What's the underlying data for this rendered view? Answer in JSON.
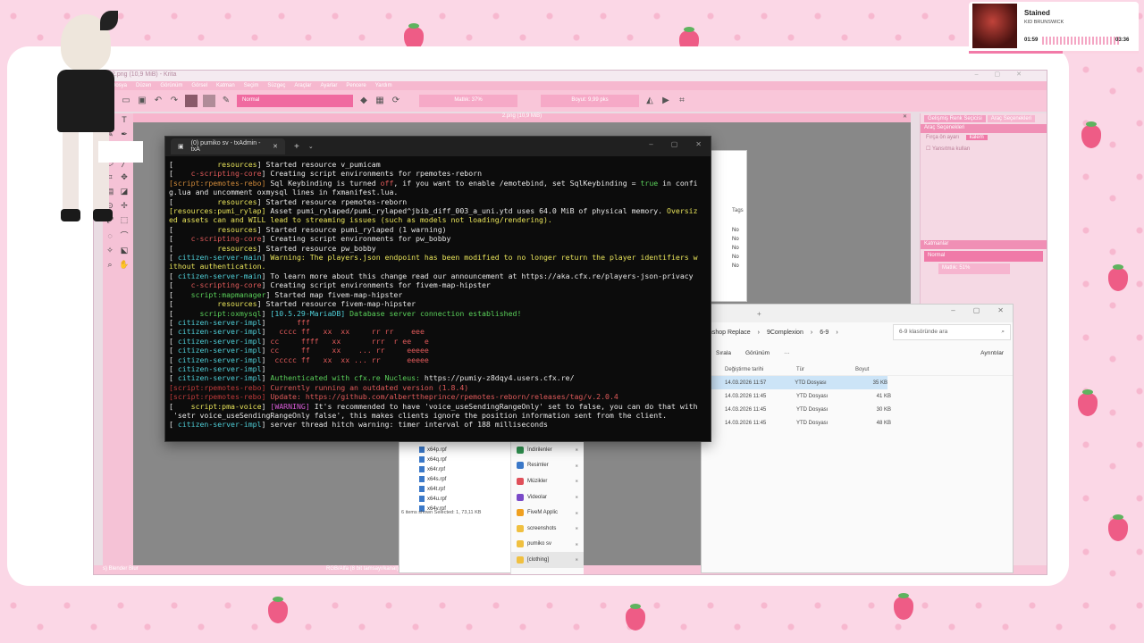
{
  "music": {
    "title": "Stained",
    "artist": "KID BRUNSWICK",
    "elapsed": "01:59",
    "total": "03:36",
    "progress": 0.55
  },
  "krita": {
    "title": "2.png (10,9 MiB) - Krita",
    "menu": [
      "Dosya",
      "Düzen",
      "Görünüm",
      "Görsel",
      "Katman",
      "Seçim",
      "Süzgeç",
      "Araçlar",
      "Ayarlar",
      "Pencere",
      "Yardım"
    ],
    "blend_mode": "Normal",
    "opacity": "Matlık: 37%",
    "size": "Boyut: 9,99 pks",
    "doc_title": "2.png (10,9 MiB)",
    "status_left": "s) Blender Blur",
    "status_mid": "RGB/Alfa (8 bit tamsayı/kanal) sRGB-elle-V2-srgbtrc.icc",
    "dock_tabs": [
      "Gelişmiş Renk Seçicisi",
      "Araç Seçenekleri"
    ],
    "fırça": {
      "label": "Araç Seçenekleri",
      "row": "Fırça ön ayarı",
      "value": "kalem",
      "check": "Yansıtma kullan"
    },
    "layers": {
      "title": "Katmanlar",
      "blend": "Normal",
      "opacity": "Matlık: 51%"
    }
  },
  "terminal": {
    "tab_title": "(0) pumiko sv - txAdmin - txA",
    "lines": [
      [
        [
          "c-w",
          "[          "
        ],
        [
          "c-y",
          "resources"
        ],
        [
          "c-w",
          "] Started resource v_pumicam"
        ]
      ],
      [
        [
          "c-w",
          "[    "
        ],
        [
          "c-r",
          "c-scripting-core"
        ],
        [
          "c-w",
          "] Creating script environments for rpemotes-reborn"
        ]
      ],
      [
        [
          "c-o",
          "[script:rpemotes-rebo]"
        ],
        [
          "c-w",
          " Sql Keybinding is turned "
        ],
        [
          "c-r",
          "off"
        ],
        [
          "c-w",
          ", if you want to enable /emotebind, set SqlKeybinding = "
        ],
        [
          "c-g",
          "true"
        ],
        [
          "c-w",
          " in confi"
        ]
      ],
      [
        [
          "c-w",
          "g.lua and uncomment oxmysql lines in fxmanifest.lua."
        ]
      ],
      [
        [
          "c-w",
          "[          "
        ],
        [
          "c-y",
          "resources"
        ],
        [
          "c-w",
          "] Started resource rpemotes-reborn"
        ]
      ],
      [
        [
          "c-y",
          "[resources:pumi_rylap]"
        ],
        [
          "c-w",
          " Asset pumi_rylaped/pumi_rylaped^jbib_diff_003_a_uni.ytd uses 64.0 MiB of physical memory. "
        ],
        [
          "c-y",
          "Oversiz"
        ]
      ],
      [
        [
          "c-y",
          "ed assets can and WILL lead to streaming issues (such as models not loading/rendering)."
        ]
      ],
      [
        [
          "c-w",
          "[          "
        ],
        [
          "c-y",
          "resources"
        ],
        [
          "c-w",
          "] Started resource pumi_rylaped (1 warning)"
        ]
      ],
      [
        [
          "c-w",
          "[    "
        ],
        [
          "c-r",
          "c-scripting-core"
        ],
        [
          "c-w",
          "] Creating script environments for pw_bobby"
        ]
      ],
      [
        [
          "c-w",
          "[          "
        ],
        [
          "c-y",
          "resources"
        ],
        [
          "c-w",
          "] Started resource pw_bobby"
        ]
      ],
      [
        [
          "c-w",
          "[ "
        ],
        [
          "c-c",
          "citizen-server-main"
        ],
        [
          "c-w",
          "] "
        ],
        [
          "c-y",
          "Warning: The players.json endpoint has been modified to no longer return the player identifiers w"
        ]
      ],
      [
        [
          "c-y",
          "ithout authentication."
        ]
      ],
      [
        [
          "c-w",
          "[ "
        ],
        [
          "c-c",
          "citizen-server-main"
        ],
        [
          "c-w",
          "] To learn more about this change read our announcement at https://aka.cfx.re/players-json-privacy"
        ]
      ],
      [
        [
          "c-w",
          "[    "
        ],
        [
          "c-r",
          "c-scripting-core"
        ],
        [
          "c-w",
          "] Creating script environments for fivem-map-hipster"
        ]
      ],
      [
        [
          "c-w",
          "[    "
        ],
        [
          "c-g",
          "script:mapmanager"
        ],
        [
          "c-w",
          "] Started map fivem-map-hipster"
        ]
      ],
      [
        [
          "c-w",
          "[          "
        ],
        [
          "c-y",
          "resources"
        ],
        [
          "c-w",
          "] Started resource fivem-map-hipster"
        ]
      ],
      [
        [
          "c-w",
          "[      "
        ],
        [
          "c-g",
          "script:oxmysql"
        ],
        [
          "c-w",
          "] "
        ],
        [
          "c-c",
          "[10.5.29-MariaDB]"
        ],
        [
          "c-g",
          " Database server connection established!"
        ]
      ],
      [
        [
          "c-w",
          "[ "
        ],
        [
          "c-c",
          "citizen-server-impl"
        ],
        [
          "c-w",
          "]       "
        ],
        [
          "c-r",
          "fff"
        ]
      ],
      [
        [
          "c-w",
          "[ "
        ],
        [
          "c-c",
          "citizen-server-impl"
        ],
        [
          "c-w",
          "]   "
        ],
        [
          "c-r",
          "cccc ff   xx  xx     rr rr    eee"
        ]
      ],
      [
        [
          "c-w",
          "[ "
        ],
        [
          "c-c",
          "citizen-server-impl"
        ],
        [
          "c-w",
          "] "
        ],
        [
          "c-r",
          "cc     ffff   xx       rrr  r ee   e"
        ]
      ],
      [
        [
          "c-w",
          "[ "
        ],
        [
          "c-c",
          "citizen-server-impl"
        ],
        [
          "c-w",
          "] "
        ],
        [
          "c-r",
          "cc     ff     xx    ... rr     eeeee"
        ]
      ],
      [
        [
          "c-w",
          "[ "
        ],
        [
          "c-c",
          "citizen-server-impl"
        ],
        [
          "c-w",
          "]  "
        ],
        [
          "c-r",
          "ccccc ff   xx  xx ... rr      eeeee"
        ]
      ],
      [
        [
          "c-w",
          "[ "
        ],
        [
          "c-c",
          "citizen-server-impl"
        ],
        [
          "c-w",
          "]"
        ]
      ],
      [
        [
          "c-w",
          "[ "
        ],
        [
          "c-c",
          "citizen-server-impl"
        ],
        [
          "c-w",
          "] "
        ],
        [
          "c-g",
          "Authenticated with cfx.re Nucleus: "
        ],
        [
          "c-w",
          "https://pumiy-z8dqy4.users.cfx.re/"
        ]
      ],
      [
        [
          "c-dr",
          "[script:rpemotes-rebo]"
        ],
        [
          "c-r",
          " Currently running an outdated version (1.8.4)"
        ]
      ],
      [
        [
          "c-dr",
          "[script:rpemotes-rebo]"
        ],
        [
          "c-r",
          " Update: https://github.com/alberttheprince/rpemotes-reborn/releases/tag/v.2.0.4"
        ]
      ],
      [
        [
          "c-w",
          "[    "
        ],
        [
          "c-y",
          "script:pma-voice"
        ],
        [
          "c-w",
          "] "
        ],
        [
          "c-m",
          "[WARNING]"
        ],
        [
          "c-w",
          " It's recommended to have 'voice_useSendingRangeOnly' set to false, you can do that with"
        ]
      ],
      [
        [
          "c-w",
          " 'setr voice_useSendingRangeOnly false', this makes clients ignore the position information sent from the client."
        ]
      ],
      [
        [
          "c-w",
          "[ "
        ],
        [
          "c-c",
          "citizen-server-impl"
        ],
        [
          "c-w",
          "] server thread hitch warning: timer interval of 188 milliseconds"
        ]
      ]
    ]
  },
  "explorer": {
    "breadcrumbs": [
      "mshop Replace",
      "9Complexion",
      "6-9"
    ],
    "search_placeholder": "6-9 klasöründe ara",
    "commands": {
      "sort": "Sırala",
      "view": "Görünüm",
      "more": "···",
      "details": "Ayrıntılar"
    },
    "columns": [
      "Değiştirme tarihi",
      "Tür",
      "Boyut"
    ],
    "rows": [
      {
        "date": "14.03.2026 11:57",
        "type": "YTD Dosyası",
        "size": "35 KB"
      },
      {
        "date": "14.03.2026 11:45",
        "type": "YTD Dosyası",
        "size": "41 KB"
      },
      {
        "date": "14.03.2026 11:45",
        "type": "YTD Dosyası",
        "size": "30 KB"
      },
      {
        "date": "14.03.2026 11:45",
        "type": "YTD Dosyası",
        "size": "48 KB"
      }
    ],
    "back_tags": "Tags",
    "back_no": [
      "No",
      "No",
      "No",
      "No",
      "No"
    ]
  },
  "explorer2": {
    "files": [
      "x64p.rpf",
      "x64q.rpf",
      "x64r.rpf",
      "x64s.rpf",
      "x64t.rpf",
      "x64u.rpf",
      "x64v.rpf"
    ],
    "status": "6 items shown   Selected: 1,   73,11 KB",
    "nav": [
      {
        "label": "İndirilenler",
        "color": "#2f8f4f"
      },
      {
        "label": "Resimler",
        "color": "#3a78c8"
      },
      {
        "label": "Müzikler",
        "color": "#e0505a"
      },
      {
        "label": "Videolar",
        "color": "#7a4ac8"
      },
      {
        "label": "FiveM Applic",
        "color": "#f0a020"
      },
      {
        "label": "screenshots",
        "color": "#f0c040"
      },
      {
        "label": "pumiko sv",
        "color": "#f0c040"
      },
      {
        "label": "[clothing]",
        "color": "#f0c040"
      }
    ]
  }
}
